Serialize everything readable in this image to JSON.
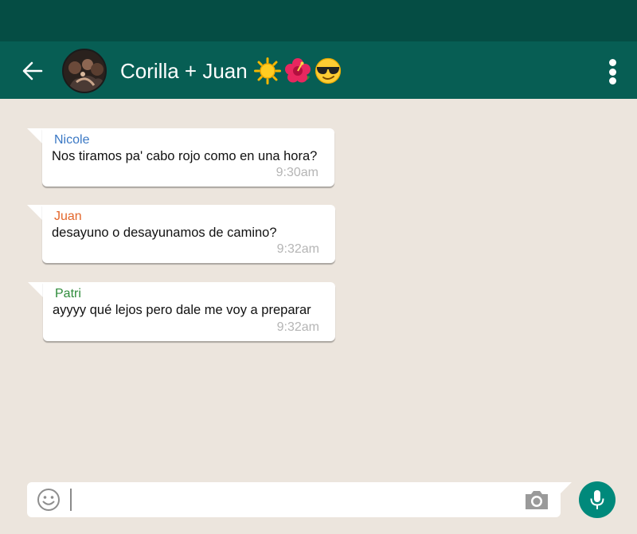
{
  "header": {
    "title": "Corilla + Juan",
    "title_emojis": [
      "sun-emoji",
      "hibiscus-emoji",
      "sunglasses-emoji"
    ],
    "back_icon": "arrow-left-icon",
    "menu_icon": "more-vertical-icon"
  },
  "messages": [
    {
      "sender": "Nicole",
      "sender_color": "#3a78c4",
      "text": "Nos tiramos pa' cabo rojo como en una hora?",
      "time": "9:30am"
    },
    {
      "sender": "Juan",
      "sender_color": "#e3662a",
      "text": "desayuno o desayunamos de camino?",
      "time": "9:32am"
    },
    {
      "sender": "Patri",
      "sender_color": "#2e8b3a",
      "text": "ayyyy qué lejos pero dale me voy a preparar",
      "time": "9:32am"
    }
  ],
  "composer": {
    "value": "",
    "emoji_icon": "smiley-icon",
    "camera_icon": "camera-icon",
    "mic_icon": "microphone-icon"
  },
  "colors": {
    "status_bar": "#054d44",
    "header": "#075e54",
    "background": "#ece5dd",
    "mic_button": "#00897b"
  }
}
